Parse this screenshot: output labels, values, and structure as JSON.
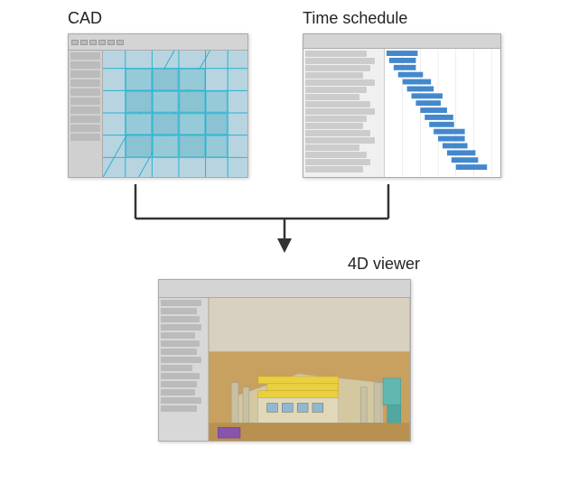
{
  "labels": {
    "cad": "CAD",
    "time_schedule": "Time schedule",
    "viewer_4d": "4D  viewer"
  },
  "colors": {
    "arrow": "#333333",
    "cad_bg": "#b8d4e0",
    "ts_bg": "#ffffff",
    "viewer_bg": "#c8a060"
  }
}
